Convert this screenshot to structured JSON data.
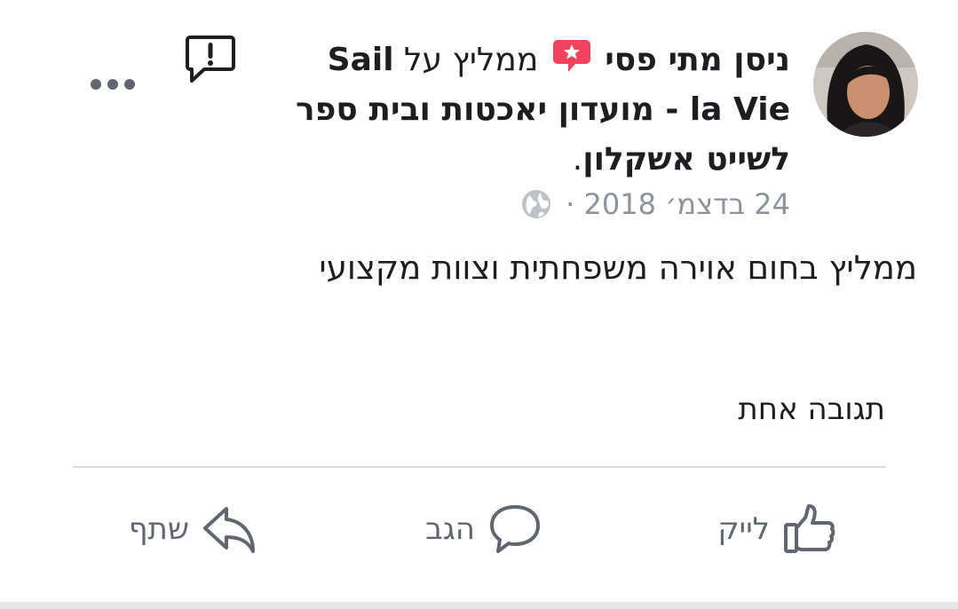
{
  "post": {
    "author": "ניסן מתי פסי",
    "action_text": "ממליץ על",
    "page_name": "Sail la Vie - מועדון יאכטות ובית ספר לשייט אשקלון",
    "page_suffix": ".",
    "date": "24 בדצמ׳ 2018",
    "separator": "·",
    "privacy_icon": "globe-icon",
    "badge_icon": "recommendation-star-icon",
    "badge_color": "#f3425f",
    "body": "ממליץ בחום אוירה משפחתית וצוות מקצועי",
    "comments_count": "תגובה אחת"
  },
  "header_icons": {
    "report": "report-icon",
    "more": "more-options-icon"
  },
  "actions": {
    "like_label": "לייק",
    "like_icon": "thumbs-up-icon",
    "comment_label": "הגב",
    "comment_icon": "comment-bubble-icon",
    "share_label": "שתף",
    "share_icon": "share-arrow-icon"
  }
}
